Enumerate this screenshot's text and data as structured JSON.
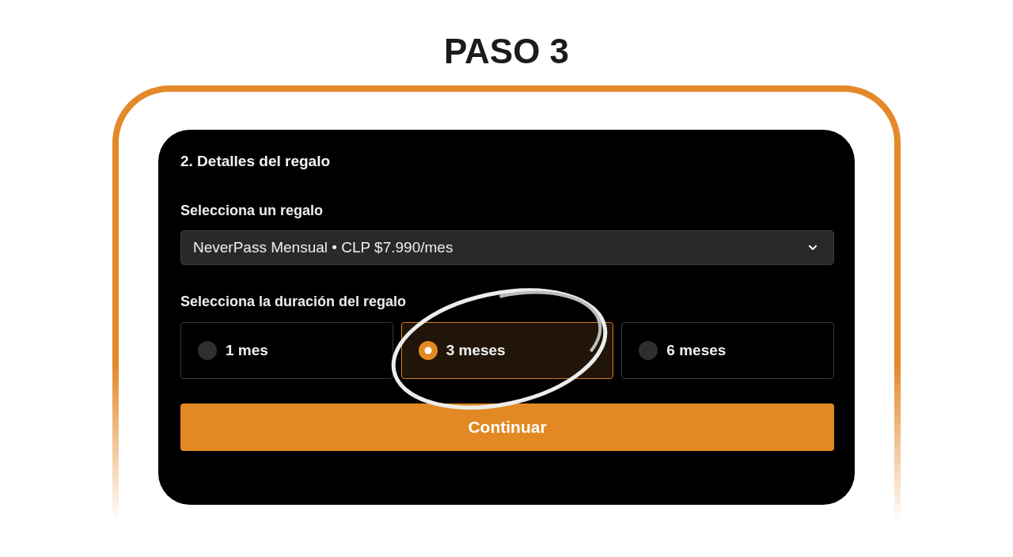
{
  "page": {
    "title": "PASO 3"
  },
  "card": {
    "title": "2. Detalles del regalo",
    "gift_select": {
      "label": "Selecciona un regalo",
      "value": "NeverPass Mensual • CLP $7.990/mes"
    },
    "duration": {
      "label": "Selecciona la duración del regalo",
      "options": [
        {
          "label": "1 mes",
          "selected": false,
          "circled": false
        },
        {
          "label": "3 meses",
          "selected": true,
          "circled": true
        },
        {
          "label": "6 meses",
          "selected": false,
          "circled": false
        }
      ]
    },
    "continue_button": {
      "label": "Continuar"
    }
  }
}
